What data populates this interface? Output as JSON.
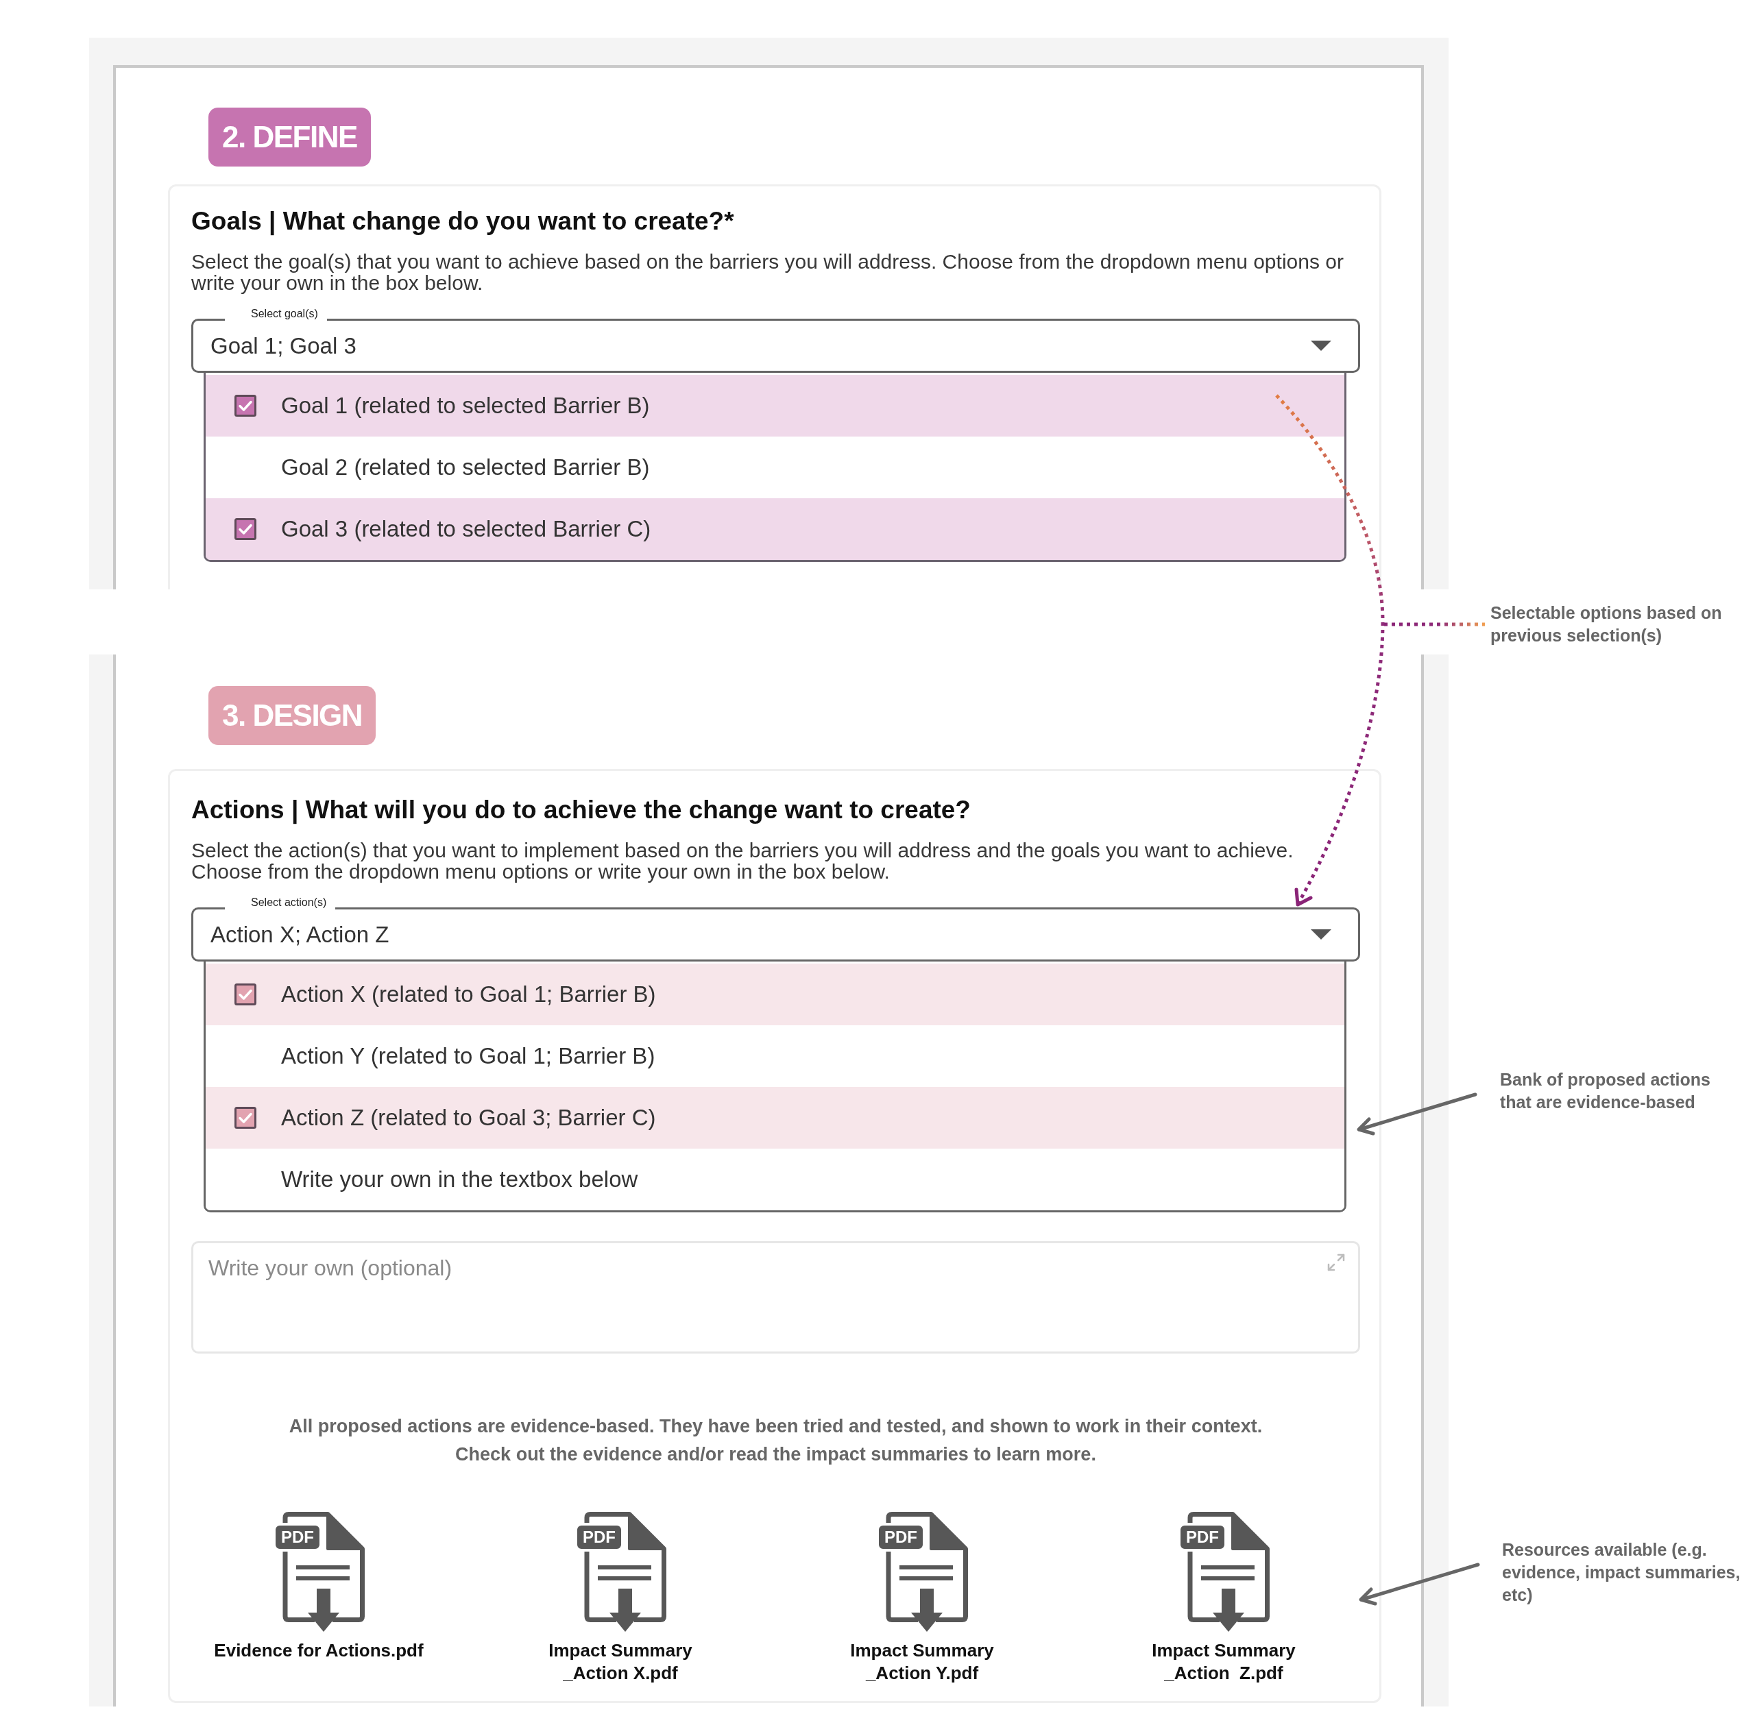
{
  "define": {
    "badge": {
      "text": "2. DEFINE",
      "color": "#c674b0"
    },
    "title": "Goals | What change do you want to create?*",
    "description": "Select the goal(s) that you want to achieve based on the barriers you will address. Choose from the dropdown menu options or write your own in the box below.",
    "select": {
      "label": "Select goal(s)",
      "value": "Goal 1; Goal 3"
    },
    "options": [
      {
        "text": "Goal 1 (related to selected Barrier B)",
        "checked": true
      },
      {
        "text": "Goal 2 (related to selected Barrier B)",
        "checked": false
      },
      {
        "text": "Goal 3 (related to selected Barrier C)",
        "checked": true
      }
    ]
  },
  "design": {
    "badge": {
      "text": "3. DESIGN",
      "color": "#e2a3b0"
    },
    "title": "Actions | What will you do to achieve the change want to create?",
    "description": "Select the action(s) that you want to implement based on the barriers you will address and the goals you want to achieve. Choose from the dropdown menu options or write your own in the box below.",
    "select": {
      "label": "Select action(s)",
      "value": "Action X; Action Z"
    },
    "options": [
      {
        "text": "Action X (related to Goal 1; Barrier B)",
        "checked": true
      },
      {
        "text": "Action Y (related to Goal 1; Barrier B)",
        "checked": false
      },
      {
        "text": "Action Z (related to Goal 3; Barrier C)",
        "checked": true
      },
      {
        "text": "Write your own in the textbox below",
        "checked": false
      }
    ],
    "textbox": {
      "placeholder": "Write your own (optional)"
    },
    "note": "All proposed actions are evidence-based. They have been tried and tested, and shown to work in their context.\nCheck out the evidence and/or read the impact summaries to learn more.",
    "resources": [
      {
        "tag": "PDF",
        "label": "Evidence for Actions.pdf"
      },
      {
        "tag": "PDF",
        "label": "Impact Summary\n_Action X.pdf"
      },
      {
        "tag": "PDF",
        "label": "Impact Summary\n_Action Y.pdf"
      },
      {
        "tag": "PDF",
        "label": "Impact Summary\n_Action  Z.pdf"
      }
    ]
  },
  "annotations": [
    {
      "text": "Selectable options based on previous selection(s)"
    },
    {
      "text": "Bank of proposed actions that are evidence-based"
    },
    {
      "text": "Resources available (e.g. evidence, impact summaries, etc)"
    }
  ]
}
